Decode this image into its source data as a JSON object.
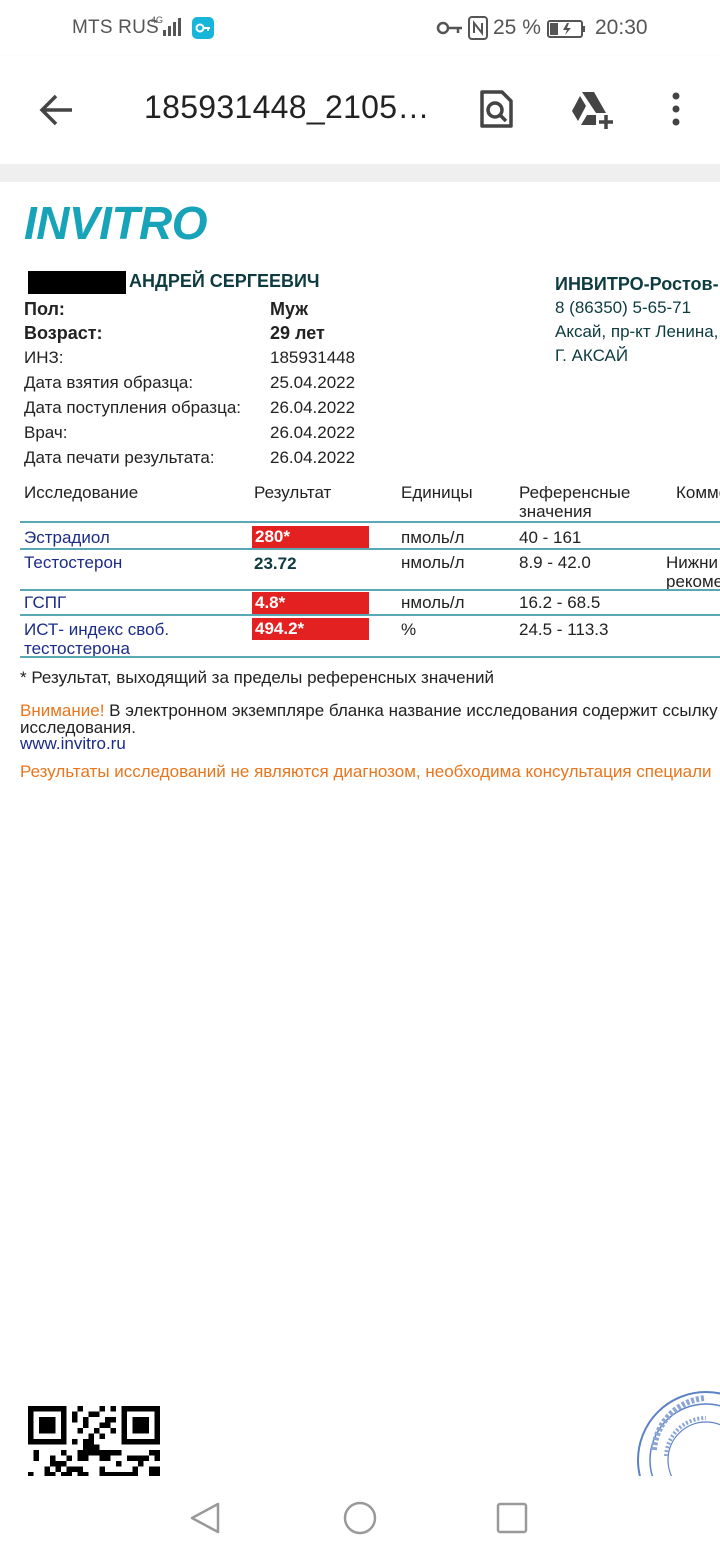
{
  "status_bar": {
    "carrier": "MTS RUS",
    "network": "4G",
    "battery": "25 %",
    "time": "20:30",
    "icons": [
      "signal-icon",
      "vpn-key-icon",
      "key-icon",
      "nfc-icon",
      "battery-charging-icon"
    ]
  },
  "app_bar": {
    "title": "185931448_2105…",
    "actions": [
      "back-arrow-icon",
      "search-document-icon",
      "drive-add-icon",
      "more-vert-icon"
    ]
  },
  "doc": {
    "logo": "INVITRO",
    "patient_name": "АНДРЕЙ СЕРГЕЕВИЧ",
    "fields": [
      {
        "label": "Пол:",
        "value": "Муж"
      },
      {
        "label": "Возраст:",
        "value": "29 лет"
      },
      {
        "label": "ИНЗ:",
        "value": "185931448"
      },
      {
        "label": "Дата взятия образца:",
        "value": "25.04.2022"
      },
      {
        "label": "Дата поступления образца:",
        "value": "26.04.2022"
      },
      {
        "label": "Врач:",
        "value": "26.04.2022"
      },
      {
        "label": "Дата печати результата:",
        "value": "26.04.2022"
      }
    ],
    "lab": {
      "name": "ИНВИТРО-Ростов-",
      "phone": "8 (86350) 5-65-71",
      "address": "Аксай, пр-кт Ленина,",
      "city": "Г. АКСАЙ"
    },
    "table": {
      "headers": {
        "test": "Исследование",
        "result": "Результат",
        "units": "Единицы",
        "ref1": "Референсные",
        "ref2": "значения",
        "comment": "Комме"
      },
      "rows": [
        {
          "test": "Эстрадиол",
          "test2": "",
          "result": "280*",
          "units": "пмоль/л",
          "ref": "40 - 161",
          "comment1": "",
          "comment2": ""
        },
        {
          "test": "Тестостерон",
          "test2": "",
          "result": "23.72",
          "units": "нмоль/л",
          "ref": "8.9 - 42.0",
          "comment1": "Нижни",
          "comment2": "рекоме"
        },
        {
          "test": "ГСПГ",
          "test2": "",
          "result": "4.8*",
          "units": "нмоль/л",
          "ref": "16.2 - 68.5",
          "comment1": "",
          "comment2": ""
        },
        {
          "test": "ИСТ- индекс своб.",
          "test2": "тестостерона",
          "result": "494.2*",
          "units": "%",
          "ref": "24.5 - 113.3",
          "comment1": "",
          "comment2": ""
        }
      ]
    },
    "footnote": "* Результат, выходящий за пределы референсных значений",
    "warning_label": "Внимание!",
    "warning_text": "В электронном экземпляре бланка название исследования содержит ссылку",
    "warning_text2": "исследования.",
    "link": "www.invitro.ru",
    "disclaimer": "Результаты исследований не являются диагнозом, необходима консультация специали"
  },
  "colors": {
    "brand": "#17a3b8",
    "flag": "#e32121",
    "warning": "#e9751c",
    "link": "#1b2b8a",
    "divider": "#5aa8b3"
  },
  "nav_bar": [
    "back-triangle-icon",
    "home-circle-icon",
    "recents-square-icon"
  ]
}
